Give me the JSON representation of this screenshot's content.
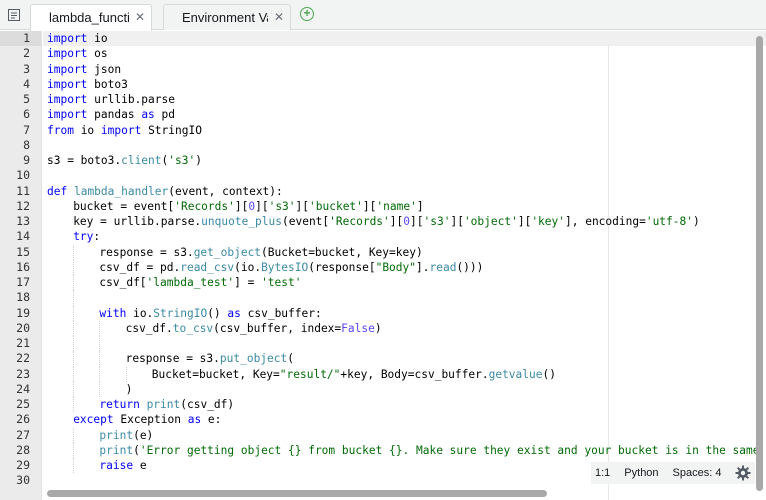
{
  "tabs": [
    {
      "label": "lambda_function",
      "active": true
    },
    {
      "label": "Environment Vari",
      "active": false
    }
  ],
  "icons": {
    "menu": "file-menu-icon",
    "close": "close-icon",
    "add": "add-tab-icon",
    "settings": "gear-icon"
  },
  "tab_close_glyph": "✕",
  "add_glyph": "+",
  "colors": {
    "keyword": "#0000ff",
    "function": "#3c8aa3",
    "string": "#036a07",
    "constant": "#5848f6",
    "add_tab": "#4ea651"
  },
  "editor": {
    "active_line": 1,
    "lines": [
      {
        "n": "1",
        "indent": 0,
        "tokens": [
          [
            "kw",
            "import"
          ],
          [
            "",
            " io"
          ]
        ]
      },
      {
        "n": "2",
        "indent": 0,
        "tokens": [
          [
            "kw",
            "import"
          ],
          [
            "",
            " os"
          ]
        ]
      },
      {
        "n": "3",
        "indent": 0,
        "tokens": [
          [
            "kw",
            "import"
          ],
          [
            "",
            " json"
          ]
        ]
      },
      {
        "n": "4",
        "indent": 0,
        "tokens": [
          [
            "kw",
            "import"
          ],
          [
            "",
            " boto3"
          ]
        ]
      },
      {
        "n": "5",
        "indent": 0,
        "tokens": [
          [
            "kw",
            "import"
          ],
          [
            "",
            " urllib.parse"
          ]
        ]
      },
      {
        "n": "6",
        "indent": 0,
        "tokens": [
          [
            "kw",
            "import"
          ],
          [
            "",
            " pandas "
          ],
          [
            "kw",
            "as"
          ],
          [
            "",
            " pd"
          ]
        ]
      },
      {
        "n": "7",
        "indent": 0,
        "tokens": [
          [
            "kw",
            "from"
          ],
          [
            "",
            " io "
          ],
          [
            "kw",
            "import"
          ],
          [
            "",
            " StringIO"
          ]
        ]
      },
      {
        "n": "8",
        "indent": 0,
        "tokens": []
      },
      {
        "n": "9",
        "indent": 0,
        "tokens": [
          [
            "",
            "s3 = boto3."
          ],
          [
            "fn",
            "client"
          ],
          [
            "",
            "("
          ],
          [
            "str",
            "'s3'"
          ],
          [
            "",
            ")"
          ]
        ]
      },
      {
        "n": "10",
        "indent": 0,
        "tokens": []
      },
      {
        "n": "11",
        "indent": 0,
        "tokens": [
          [
            "kw",
            "def"
          ],
          [
            "",
            " "
          ],
          [
            "fn",
            "lambda_handler"
          ],
          [
            "",
            "(event, context):"
          ]
        ]
      },
      {
        "n": "12",
        "indent": 1,
        "tokens": [
          [
            "",
            "bucket = event["
          ],
          [
            "str",
            "'Records'"
          ],
          [
            "",
            "]["
          ],
          [
            "cn",
            "0"
          ],
          [
            "",
            "]["
          ],
          [
            "str",
            "'s3'"
          ],
          [
            "",
            "]["
          ],
          [
            "str",
            "'bucket'"
          ],
          [
            "",
            "]["
          ],
          [
            "str",
            "'name'"
          ],
          [
            "",
            "]"
          ]
        ]
      },
      {
        "n": "13",
        "indent": 1,
        "tokens": [
          [
            "",
            "key = urllib.parse."
          ],
          [
            "fn",
            "unquote_plus"
          ],
          [
            "",
            "(event["
          ],
          [
            "str",
            "'Records'"
          ],
          [
            "",
            "]["
          ],
          [
            "cn",
            "0"
          ],
          [
            "",
            "]["
          ],
          [
            "str",
            "'s3'"
          ],
          [
            "",
            "]["
          ],
          [
            "str",
            "'object'"
          ],
          [
            "",
            "]["
          ],
          [
            "str",
            "'key'"
          ],
          [
            "",
            "], encoding="
          ],
          [
            "str",
            "'utf-8'"
          ],
          [
            "",
            ")"
          ]
        ]
      },
      {
        "n": "14",
        "indent": 1,
        "tokens": [
          [
            "kw",
            "try"
          ],
          [
            "",
            ":"
          ]
        ]
      },
      {
        "n": "15",
        "indent": 2,
        "tokens": [
          [
            "",
            "response = s3."
          ],
          [
            "fn",
            "get_object"
          ],
          [
            "",
            "(Bucket=bucket, Key=key)"
          ]
        ]
      },
      {
        "n": "16",
        "indent": 2,
        "tokens": [
          [
            "",
            "csv_df = pd."
          ],
          [
            "fn",
            "read_csv"
          ],
          [
            "",
            "(io."
          ],
          [
            "fn",
            "BytesIO"
          ],
          [
            "",
            "(response["
          ],
          [
            "str",
            "\"Body\""
          ],
          [
            "",
            "]."
          ],
          [
            "fn",
            "read"
          ],
          [
            "",
            "()))"
          ]
        ]
      },
      {
        "n": "17",
        "indent": 2,
        "tokens": [
          [
            "",
            "csv_df["
          ],
          [
            "str",
            "'lambda_test'"
          ],
          [
            "",
            "] = "
          ],
          [
            "str",
            "'test'"
          ]
        ]
      },
      {
        "n": "18",
        "indent": 2,
        "tokens": []
      },
      {
        "n": "19",
        "indent": 2,
        "tokens": [
          [
            "kw",
            "with"
          ],
          [
            "",
            " io."
          ],
          [
            "fn",
            "StringIO"
          ],
          [
            "",
            "() "
          ],
          [
            "kw",
            "as"
          ],
          [
            "",
            " csv_buffer:"
          ]
        ]
      },
      {
        "n": "20",
        "indent": 3,
        "tokens": [
          [
            "",
            "csv_df."
          ],
          [
            "fn",
            "to_csv"
          ],
          [
            "",
            "(csv_buffer, index="
          ],
          [
            "cn",
            "False"
          ],
          [
            "",
            ")"
          ]
        ]
      },
      {
        "n": "21",
        "indent": 3,
        "tokens": []
      },
      {
        "n": "22",
        "indent": 3,
        "tokens": [
          [
            "",
            "response = s3."
          ],
          [
            "fn",
            "put_object"
          ],
          [
            "",
            "("
          ]
        ]
      },
      {
        "n": "23",
        "indent": 4,
        "tokens": [
          [
            "",
            "Bucket=bucket, Key="
          ],
          [
            "str",
            "\"result/\""
          ],
          [
            "",
            "+key, Body=csv_buffer."
          ],
          [
            "fn",
            "getvalue"
          ],
          [
            "",
            "()"
          ]
        ]
      },
      {
        "n": "24",
        "indent": 3,
        "tokens": [
          [
            "",
            ")"
          ]
        ]
      },
      {
        "n": "25",
        "indent": 2,
        "tokens": [
          [
            "kw",
            "return"
          ],
          [
            "",
            " "
          ],
          [
            "fn",
            "print"
          ],
          [
            "",
            "(csv_df)"
          ]
        ]
      },
      {
        "n": "26",
        "indent": 1,
        "tokens": [
          [
            "kw",
            "except"
          ],
          [
            "",
            " Exception "
          ],
          [
            "kw",
            "as"
          ],
          [
            "",
            " e:"
          ]
        ]
      },
      {
        "n": "27",
        "indent": 2,
        "tokens": [
          [
            "fn",
            "print"
          ],
          [
            "",
            "(e)"
          ]
        ]
      },
      {
        "n": "28",
        "indent": 2,
        "tokens": [
          [
            "fn",
            "print"
          ],
          [
            "",
            "("
          ],
          [
            "str",
            "'Error getting object {} from bucket {}. Make sure they exist and your bucket is in the same re"
          ]
        ]
      },
      {
        "n": "29",
        "indent": 2,
        "tokens": [
          [
            "kw",
            "raise"
          ],
          [
            "",
            " e"
          ]
        ]
      },
      {
        "n": "30",
        "indent": 0,
        "tokens": []
      }
    ]
  },
  "status": {
    "cursor": "1:1",
    "language": "Python",
    "spaces": "Spaces: 4"
  }
}
